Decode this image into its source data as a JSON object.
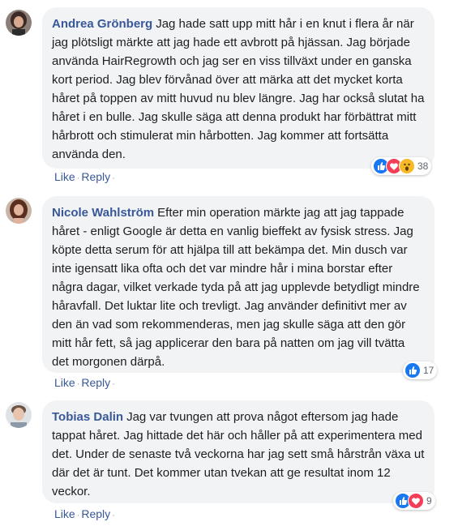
{
  "comments": [
    {
      "author": "Andrea Grönberg",
      "text": "Jag hade satt upp mitt hår i en knut i flera år när jag plötsligt märkte att jag hade ett avbrott på hjässan. Jag började använda HairRegrowth och jag ser en viss tillväxt under en ganska kort period. Jag blev förvånad över att märka att det mycket korta håret på toppen av mitt huvud nu blev längre. Jag har också slutat ha håret i en bulle. Jag skulle säga att denna produkt har förbättrat mitt hårbrott och stimulerat min hårbotten. Jag kommer att fortsätta använda den.",
      "like_label": "Like",
      "reply_label": "Reply",
      "reaction_icons": [
        "like-icon",
        "love-icon",
        "wow-icon"
      ],
      "reaction_count": "38",
      "avatar_colors": {
        "hair": "#3b2a26",
        "skin": "#d9a98f",
        "bg": "#8c7e78"
      }
    },
    {
      "author": "Nicole Wahlström",
      "text": "Efter min operation märkte jag att jag tappade håret - enligt Google är detta en vanlig bieffekt av fysisk stress. Jag köpte detta serum för att hjälpa till att bekämpa det. Min dusch var inte igensatt lika ofta och det var mindre hår i mina borstar efter några dagar, vilket verkade tyda på att jag upplevde betydligt mindre håravfall. Det luktar lite och trevligt. Jag använder definitivt mer av den än vad som rekommenderas, men jag skulle säga att den gör mitt hår fett, så jag applicerar den bara på natten om jag vill tvätta det morgonen därpå.",
      "like_label": "Like",
      "reply_label": "Reply",
      "reaction_icons": [
        "like-icon"
      ],
      "reaction_count": "17",
      "avatar_colors": {
        "hair": "#5a2f1f",
        "skin": "#e0b49c",
        "bg": "#c9b6a6"
      }
    },
    {
      "author": "Tobias Dalin",
      "text": "Jag var tvungen att prova något eftersom jag hade tappat håret. Jag hittade det här och håller på att experimentera med det. Under de senaste två veckorna har jag sett små hårstrån växa ut där det är tunt. Det kommer utan tvekan att ge resultat inom 12 veckor.",
      "like_label": "Like",
      "reply_label": "Reply",
      "reaction_icons": [
        "like-icon",
        "love-icon"
      ],
      "reaction_count": "9",
      "avatar_colors": {
        "hair": "#6b5446",
        "skin": "#e8c4ae",
        "bg": "#dfe3e6"
      }
    }
  ],
  "separator": "·"
}
